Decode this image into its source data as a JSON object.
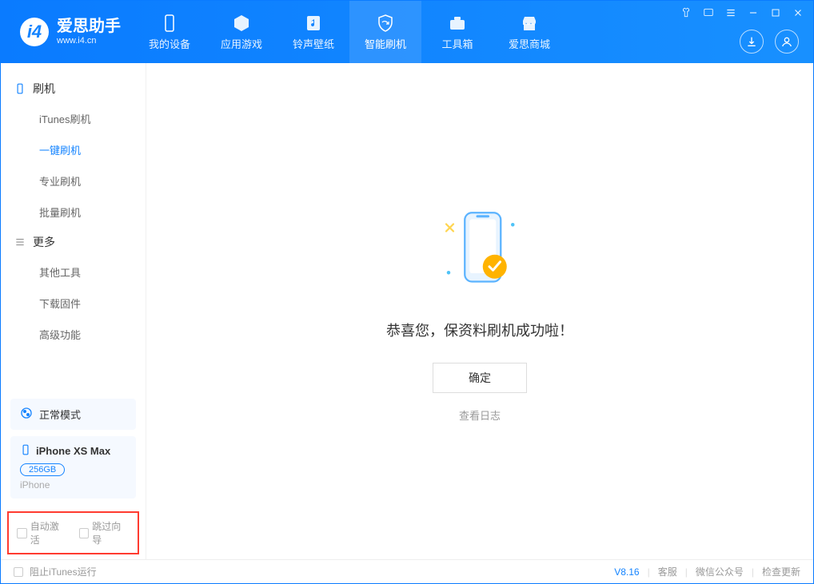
{
  "app": {
    "title": "爱思助手",
    "subtitle": "www.i4.cn"
  },
  "nav": {
    "items": [
      {
        "label": "我的设备"
      },
      {
        "label": "应用游戏"
      },
      {
        "label": "铃声壁纸"
      },
      {
        "label": "智能刷机"
      },
      {
        "label": "工具箱"
      },
      {
        "label": "爱思商城"
      }
    ],
    "active": 3
  },
  "sidebar": {
    "group1": {
      "title": "刷机",
      "items": [
        "iTunes刷机",
        "一键刷机",
        "专业刷机",
        "批量刷机"
      ],
      "active": 1
    },
    "group2": {
      "title": "更多",
      "items": [
        "其他工具",
        "下载固件",
        "高级功能"
      ]
    },
    "mode": "正常模式",
    "device": {
      "name": "iPhone XS Max",
      "capacity": "256GB",
      "type": "iPhone"
    },
    "checkboxes": {
      "auto_activate": "自动激活",
      "skip_guide": "跳过向导"
    }
  },
  "main": {
    "success_text": "恭喜您，保资料刷机成功啦！",
    "ok_label": "确定",
    "view_log_label": "查看日志"
  },
  "footer": {
    "block_itunes": "阻止iTunes运行",
    "version": "V8.16",
    "links": [
      "客服",
      "微信公众号",
      "检查更新"
    ]
  }
}
